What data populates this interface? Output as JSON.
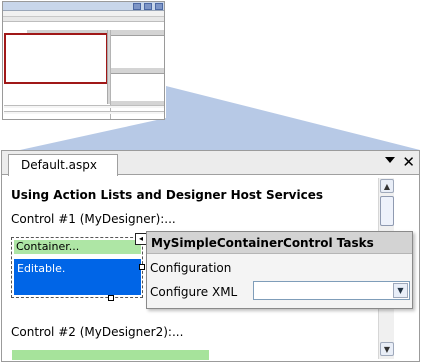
{
  "document_tab": {
    "label": "Default.aspx"
  },
  "page": {
    "heading": "Using Action Lists and Designer Host Services",
    "control1_label": "Control #1 (MyDesigner):...",
    "control2_label": "Control #2 (MyDesigner2):..."
  },
  "container": {
    "header": "Container...",
    "editable": "Editable."
  },
  "smart_tag": {
    "glyph": "◂"
  },
  "tasks_panel": {
    "title": "MySimpleContainerControl Tasks",
    "configuration_label": "Configuration",
    "configure_xml_label": "Configure XML",
    "configure_xml_value": ""
  },
  "icons": {
    "tab_menu": "dropdown-triangle-icon",
    "close": "close-icon",
    "scroll_up": "scroll-up-icon",
    "scroll_down": "scroll-down-icon",
    "select_arrow": "chevron-down-icon"
  },
  "colors": {
    "selection": "#0065e7",
    "container_header": "#aee6a5",
    "thumbnail_highlight": "#a01818"
  }
}
